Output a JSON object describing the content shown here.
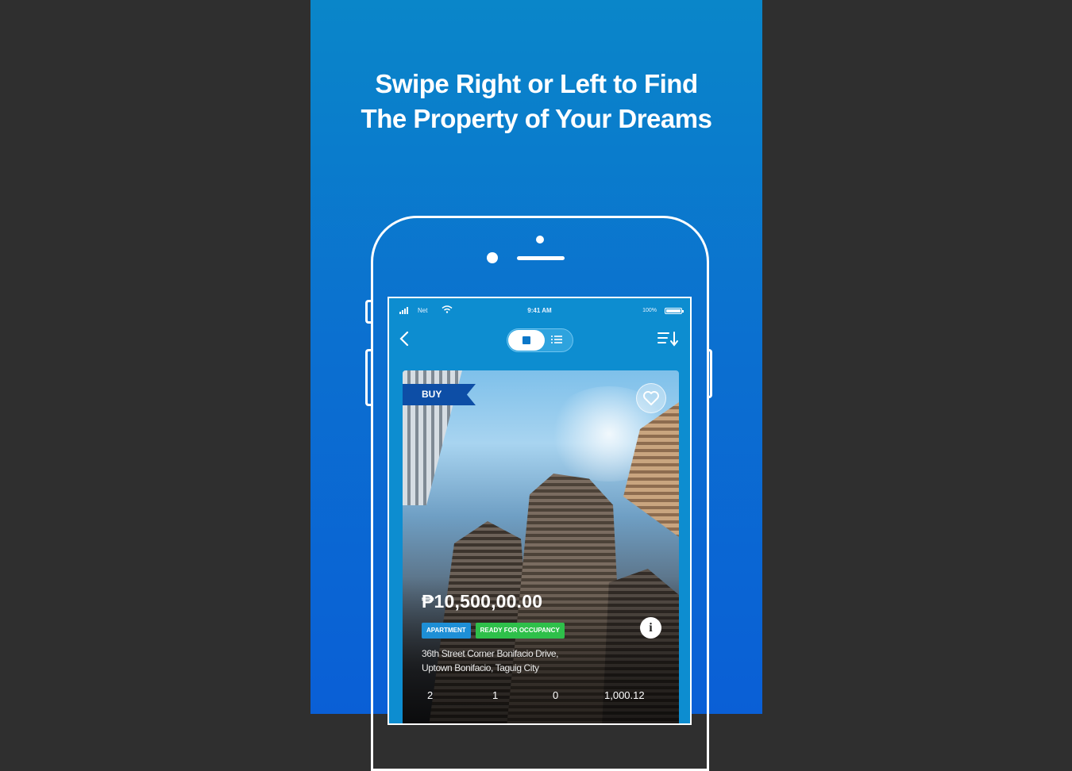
{
  "headline": {
    "line1": "Swipe Right or Left to Find",
    "line2": "The Property of Your Dreams"
  },
  "status_bar": {
    "carrier": "Net",
    "time": "9:41 AM",
    "battery": "100%"
  },
  "nav": {
    "back_icon": "chevron-left-icon",
    "view_toggle": {
      "selected": "card",
      "options": [
        "card",
        "list"
      ]
    },
    "sort_icon": "sort-icon"
  },
  "listing": {
    "badge": "BUY",
    "price": "₱10,500,00.00",
    "tags": [
      "APARTMENT",
      "READY FOR OCCUPANCY"
    ],
    "address_line1": "36th Street Corner Bonifacio Drive,",
    "address_line2": "Uptown Bonifacio, Taguig City",
    "stats": [
      "2",
      "1",
      "0",
      "1,000.12"
    ]
  },
  "colors": {
    "background": "#2f2f2f",
    "panel_top": "#0a86c9",
    "panel_bottom": "#0a5fd6",
    "badge_blue": "#0d4ea6",
    "tag_type": "#1e8fd6",
    "tag_status": "#2ec04a"
  }
}
